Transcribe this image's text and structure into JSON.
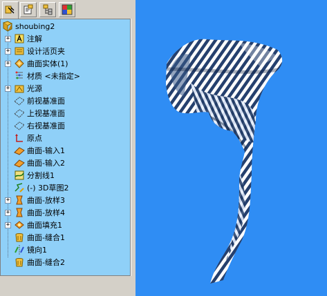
{
  "tabs": [
    {
      "name": "feature-manager-tab",
      "icon": "feature-tree-icon",
      "active": true
    },
    {
      "name": "property-manager-tab",
      "icon": "property-icon",
      "active": false
    },
    {
      "name": "configuration-manager-tab",
      "icon": "configuration-icon",
      "active": false
    },
    {
      "name": "display-manager-tab",
      "icon": "display-icon",
      "active": false
    }
  ],
  "tree": {
    "root": {
      "label": "shoubing2",
      "icon": "part-icon"
    },
    "items": [
      {
        "label": "注解",
        "icon": "annotation-icon",
        "expander": "+"
      },
      {
        "label": "设计活页夹",
        "icon": "design-binder-icon",
        "expander": "+"
      },
      {
        "label": "曲面实体(1)",
        "icon": "surface-bodies-icon",
        "expander": "+"
      },
      {
        "label": "材质 <未指定>",
        "icon": "material-icon",
        "expander": ""
      },
      {
        "label": "光源",
        "icon": "lights-icon",
        "expander": "+"
      },
      {
        "label": "前视基准面",
        "icon": "plane-icon",
        "expander": ""
      },
      {
        "label": "上视基准面",
        "icon": "plane-icon",
        "expander": ""
      },
      {
        "label": "右视基准面",
        "icon": "plane-icon",
        "expander": ""
      },
      {
        "label": "原点",
        "icon": "origin-icon",
        "expander": ""
      },
      {
        "label": "曲面-输入1",
        "icon": "imported-surface-icon",
        "expander": ""
      },
      {
        "label": "曲面-输入2",
        "icon": "imported-surface-icon",
        "expander": ""
      },
      {
        "label": "分割线1",
        "icon": "split-line-icon",
        "expander": ""
      },
      {
        "label": "(-) 3D草图2",
        "icon": "3d-sketch-icon",
        "expander": ""
      },
      {
        "label": "曲面-放样3",
        "icon": "surface-loft-icon",
        "expander": "+"
      },
      {
        "label": "曲面-放样4",
        "icon": "surface-loft-icon",
        "expander": "+"
      },
      {
        "label": "曲面填充1",
        "icon": "filled-surface-icon",
        "expander": "+"
      },
      {
        "label": "曲面-缝合1",
        "icon": "surface-knit-icon",
        "expander": ""
      },
      {
        "label": "镜向1",
        "icon": "mirror-icon",
        "expander": ""
      },
      {
        "label": "曲面-缝合2",
        "icon": "surface-knit-icon",
        "expander": ""
      }
    ]
  },
  "viewport": {
    "content": "zebra-stripes-handle-model",
    "background": "#2f8df4"
  }
}
